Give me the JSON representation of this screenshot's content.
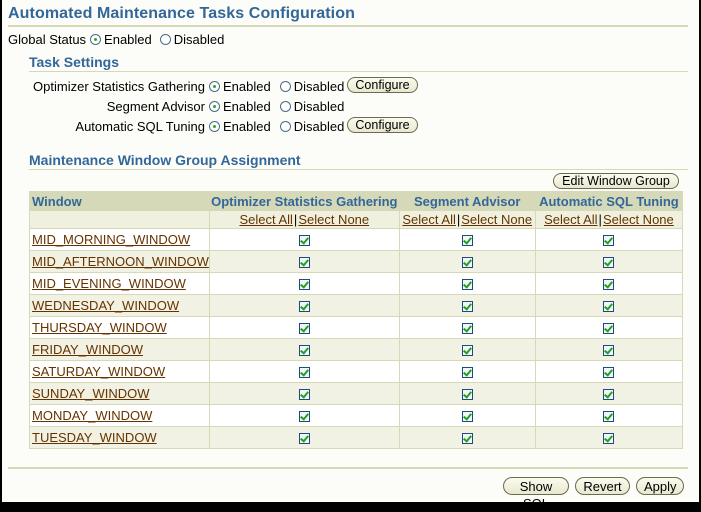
{
  "page": {
    "title": "Automated Maintenance Tasks Configuration"
  },
  "global_status": {
    "label": "Global Status",
    "options": [
      {
        "label": "Enabled",
        "selected": true
      },
      {
        "label": "Disabled",
        "selected": false
      }
    ]
  },
  "task_settings": {
    "title": "Task Settings",
    "tasks": [
      {
        "label": "Optimizer Statistics Gathering",
        "enabled_label": "Enabled",
        "disabled_label": "Disabled",
        "enabled": true,
        "configure_label": "Configure",
        "has_configure": true
      },
      {
        "label": "Segment Advisor",
        "enabled_label": "Enabled",
        "disabled_label": "Disabled",
        "enabled": true,
        "has_configure": false
      },
      {
        "label": "Automatic SQL Tuning",
        "enabled_label": "Enabled",
        "disabled_label": "Disabled",
        "enabled": true,
        "configure_label": "Configure",
        "has_configure": true
      }
    ]
  },
  "window_group": {
    "title": "Maintenance Window Group Assignment",
    "edit_button": "Edit Window Group",
    "columns": [
      "Window",
      "Optimizer Statistics Gathering",
      "Segment Advisor",
      "Automatic SQL Tuning"
    ],
    "select_all": "Select All",
    "select_none": "Select None",
    "separator": "|",
    "rows": [
      {
        "window": "MID_MORNING_WINDOW",
        "checks": [
          true,
          true,
          true
        ]
      },
      {
        "window": "MID_AFTERNOON_WINDOW",
        "checks": [
          true,
          true,
          true
        ]
      },
      {
        "window": "MID_EVENING_WINDOW",
        "checks": [
          true,
          true,
          true
        ]
      },
      {
        "window": "WEDNESDAY_WINDOW",
        "checks": [
          true,
          true,
          true
        ]
      },
      {
        "window": "THURSDAY_WINDOW",
        "checks": [
          true,
          true,
          true
        ]
      },
      {
        "window": "FRIDAY_WINDOW",
        "checks": [
          true,
          true,
          true
        ]
      },
      {
        "window": "SATURDAY_WINDOW",
        "checks": [
          true,
          true,
          true
        ]
      },
      {
        "window": "SUNDAY_WINDOW",
        "checks": [
          true,
          true,
          true
        ]
      },
      {
        "window": "MONDAY_WINDOW",
        "checks": [
          true,
          true,
          true
        ]
      },
      {
        "window": "TUESDAY_WINDOW",
        "checks": [
          true,
          true,
          true
        ]
      }
    ]
  },
  "footer": {
    "show_sql": "Show SQL",
    "revert": "Revert",
    "apply": "Apply"
  },
  "colors": {
    "heading": "#336699",
    "link": "#663300",
    "header_bg": "#d5d9b8",
    "page_bg": "#fcfdf8"
  }
}
